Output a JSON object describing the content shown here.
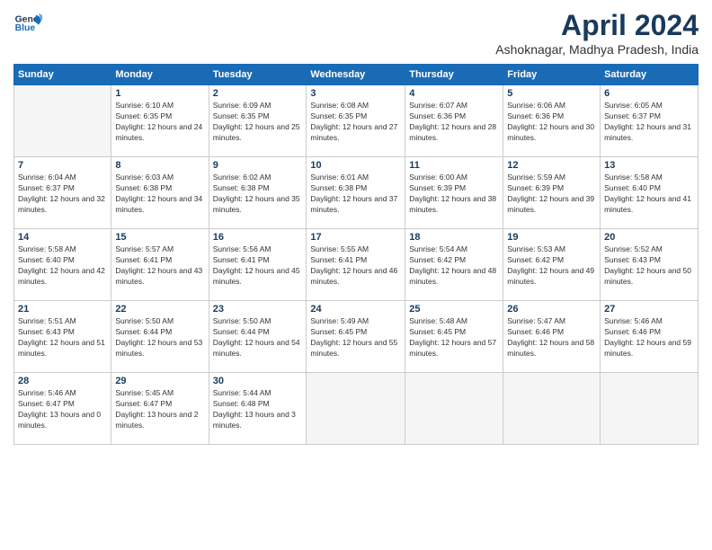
{
  "header": {
    "logo_line1": "General",
    "logo_line2": "Blue",
    "title": "April 2024",
    "subtitle": "Ashoknagar, Madhya Pradesh, India"
  },
  "weekdays": [
    "Sunday",
    "Monday",
    "Tuesday",
    "Wednesday",
    "Thursday",
    "Friday",
    "Saturday"
  ],
  "weeks": [
    [
      {
        "day": "",
        "empty": true
      },
      {
        "day": "1",
        "sunrise": "6:10 AM",
        "sunset": "6:35 PM",
        "daylight": "12 hours and 24 minutes."
      },
      {
        "day": "2",
        "sunrise": "6:09 AM",
        "sunset": "6:35 PM",
        "daylight": "12 hours and 25 minutes."
      },
      {
        "day": "3",
        "sunrise": "6:08 AM",
        "sunset": "6:35 PM",
        "daylight": "12 hours and 27 minutes."
      },
      {
        "day": "4",
        "sunrise": "6:07 AM",
        "sunset": "6:36 PM",
        "daylight": "12 hours and 28 minutes."
      },
      {
        "day": "5",
        "sunrise": "6:06 AM",
        "sunset": "6:36 PM",
        "daylight": "12 hours and 30 minutes."
      },
      {
        "day": "6",
        "sunrise": "6:05 AM",
        "sunset": "6:37 PM",
        "daylight": "12 hours and 31 minutes."
      }
    ],
    [
      {
        "day": "7",
        "sunrise": "6:04 AM",
        "sunset": "6:37 PM",
        "daylight": "12 hours and 32 minutes."
      },
      {
        "day": "8",
        "sunrise": "6:03 AM",
        "sunset": "6:38 PM",
        "daylight": "12 hours and 34 minutes."
      },
      {
        "day": "9",
        "sunrise": "6:02 AM",
        "sunset": "6:38 PM",
        "daylight": "12 hours and 35 minutes."
      },
      {
        "day": "10",
        "sunrise": "6:01 AM",
        "sunset": "6:38 PM",
        "daylight": "12 hours and 37 minutes."
      },
      {
        "day": "11",
        "sunrise": "6:00 AM",
        "sunset": "6:39 PM",
        "daylight": "12 hours and 38 minutes."
      },
      {
        "day": "12",
        "sunrise": "5:59 AM",
        "sunset": "6:39 PM",
        "daylight": "12 hours and 39 minutes."
      },
      {
        "day": "13",
        "sunrise": "5:58 AM",
        "sunset": "6:40 PM",
        "daylight": "12 hours and 41 minutes."
      }
    ],
    [
      {
        "day": "14",
        "sunrise": "5:58 AM",
        "sunset": "6:40 PM",
        "daylight": "12 hours and 42 minutes."
      },
      {
        "day": "15",
        "sunrise": "5:57 AM",
        "sunset": "6:41 PM",
        "daylight": "12 hours and 43 minutes."
      },
      {
        "day": "16",
        "sunrise": "5:56 AM",
        "sunset": "6:41 PM",
        "daylight": "12 hours and 45 minutes."
      },
      {
        "day": "17",
        "sunrise": "5:55 AM",
        "sunset": "6:41 PM",
        "daylight": "12 hours and 46 minutes."
      },
      {
        "day": "18",
        "sunrise": "5:54 AM",
        "sunset": "6:42 PM",
        "daylight": "12 hours and 48 minutes."
      },
      {
        "day": "19",
        "sunrise": "5:53 AM",
        "sunset": "6:42 PM",
        "daylight": "12 hours and 49 minutes."
      },
      {
        "day": "20",
        "sunrise": "5:52 AM",
        "sunset": "6:43 PM",
        "daylight": "12 hours and 50 minutes."
      }
    ],
    [
      {
        "day": "21",
        "sunrise": "5:51 AM",
        "sunset": "6:43 PM",
        "daylight": "12 hours and 51 minutes."
      },
      {
        "day": "22",
        "sunrise": "5:50 AM",
        "sunset": "6:44 PM",
        "daylight": "12 hours and 53 minutes."
      },
      {
        "day": "23",
        "sunrise": "5:50 AM",
        "sunset": "6:44 PM",
        "daylight": "12 hours and 54 minutes."
      },
      {
        "day": "24",
        "sunrise": "5:49 AM",
        "sunset": "6:45 PM",
        "daylight": "12 hours and 55 minutes."
      },
      {
        "day": "25",
        "sunrise": "5:48 AM",
        "sunset": "6:45 PM",
        "daylight": "12 hours and 57 minutes."
      },
      {
        "day": "26",
        "sunrise": "5:47 AM",
        "sunset": "6:46 PM",
        "daylight": "12 hours and 58 minutes."
      },
      {
        "day": "27",
        "sunrise": "5:46 AM",
        "sunset": "6:46 PM",
        "daylight": "12 hours and 59 minutes."
      }
    ],
    [
      {
        "day": "28",
        "sunrise": "5:46 AM",
        "sunset": "6:47 PM",
        "daylight": "13 hours and 0 minutes."
      },
      {
        "day": "29",
        "sunrise": "5:45 AM",
        "sunset": "6:47 PM",
        "daylight": "13 hours and 2 minutes."
      },
      {
        "day": "30",
        "sunrise": "5:44 AM",
        "sunset": "6:48 PM",
        "daylight": "13 hours and 3 minutes."
      },
      {
        "day": "",
        "empty": true
      },
      {
        "day": "",
        "empty": true
      },
      {
        "day": "",
        "empty": true
      },
      {
        "day": "",
        "empty": true
      }
    ]
  ]
}
